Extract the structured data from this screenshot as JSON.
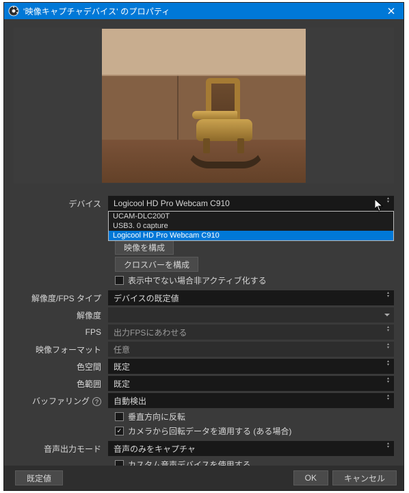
{
  "window": {
    "title": "'映像キャプチャデバイス' のプロパティ"
  },
  "device": {
    "label": "デバイス",
    "selected": "Logicool HD Pro Webcam C910",
    "options": [
      "UCAM-DLC200T",
      "USB3. 0 capture",
      "Logicool HD Pro Webcam C910"
    ]
  },
  "buttons": {
    "configure_video": "映像を構成",
    "configure_crossbar": "クロスバーを構成"
  },
  "checkboxes": {
    "deactivate_when_not_shown": "表示中でない場合非アクティブ化する",
    "flip_vertical": "垂直方向に反転",
    "apply_rotation": "カメラから回転データを適用する (ある場合)",
    "apply_rotation_checked": true,
    "custom_audio_device": "カスタム音声デバイスを使用する"
  },
  "rows": {
    "res_fps_type": {
      "label": "解像度/FPS タイプ",
      "value": "デバイスの既定値"
    },
    "resolution": {
      "label": "解像度",
      "value": ""
    },
    "fps": {
      "label": "FPS",
      "value": "出力FPSにあわせる"
    },
    "format": {
      "label": "映像フォーマット",
      "value": "任意"
    },
    "colorspace": {
      "label": "色空間",
      "value": "既定"
    },
    "colorrange": {
      "label": "色範囲",
      "value": "既定"
    },
    "buffering": {
      "label": "バッファリング",
      "value": "自動検出"
    },
    "audio_mode": {
      "label": "音声出力モード",
      "value": "音声のみをキャプチャ"
    }
  },
  "footer": {
    "defaults": "既定値",
    "ok": "OK",
    "cancel": "キャンセル"
  }
}
